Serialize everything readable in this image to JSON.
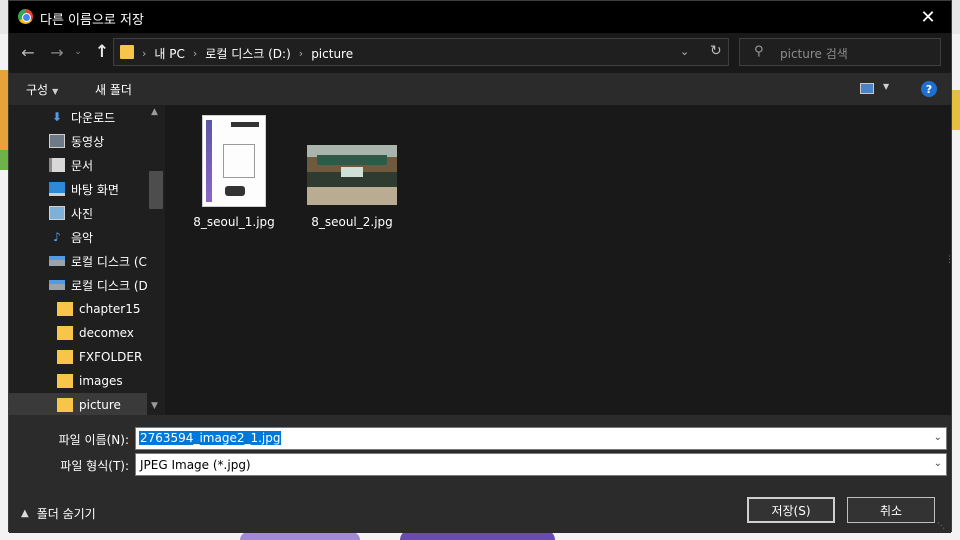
{
  "dialog": {
    "title": "다른 이름으로 저장",
    "close_glyph": "✕"
  },
  "address": {
    "breadcrumbs": [
      "내 PC",
      "로컬 디스크 (D:)",
      "picture"
    ],
    "sep_glyph": "›",
    "dropdown_glyph": "⌄",
    "refresh_glyph": "↻"
  },
  "search": {
    "placeholder": "picture 검색",
    "icon_glyph": "⚲"
  },
  "toolbar": {
    "organize_label": "구성",
    "new_folder_label": "새 폴더",
    "help_glyph": "?"
  },
  "nav": {
    "items": [
      {
        "label": "다운로드",
        "icon": "download-icon"
      },
      {
        "label": "동영상",
        "icon": "video-icon"
      },
      {
        "label": "문서",
        "icon": "document-icon"
      },
      {
        "label": "바탕 화면",
        "icon": "desktop-icon"
      },
      {
        "label": "사진",
        "icon": "photo-icon"
      },
      {
        "label": "음악",
        "icon": "music-icon"
      },
      {
        "label": "로컬 디스크 (C",
        "icon": "drive-icon"
      },
      {
        "label": "로컬 디스크 (D",
        "icon": "drive-icon"
      },
      {
        "label": "chapter15",
        "icon": "folder-icon"
      },
      {
        "label": "decomex",
        "icon": "folder-icon"
      },
      {
        "label": "FXFOLDER",
        "icon": "folder-icon"
      },
      {
        "label": "images",
        "icon": "folder-icon"
      },
      {
        "label": "picture",
        "icon": "folder-icon",
        "selected": true
      }
    ]
  },
  "files": [
    {
      "name": "8_seoul_1.jpg"
    },
    {
      "name": "8_seoul_2.jpg"
    }
  ],
  "form": {
    "filename_label": "파일 이름(N):",
    "filename_value": "2763594_image2_1.jpg",
    "filetype_label": "파일 형식(T):",
    "filetype_value": "JPEG Image (*.jpg)",
    "hide_folders_label": "폴더 숨기기",
    "save_label": "저장(S)",
    "cancel_label": "취소"
  },
  "colors": {
    "accent": "#0078d7",
    "dialog_bg": "#2b2b2b",
    "pane_bg": "#191919",
    "folder": "#f6c54a"
  }
}
